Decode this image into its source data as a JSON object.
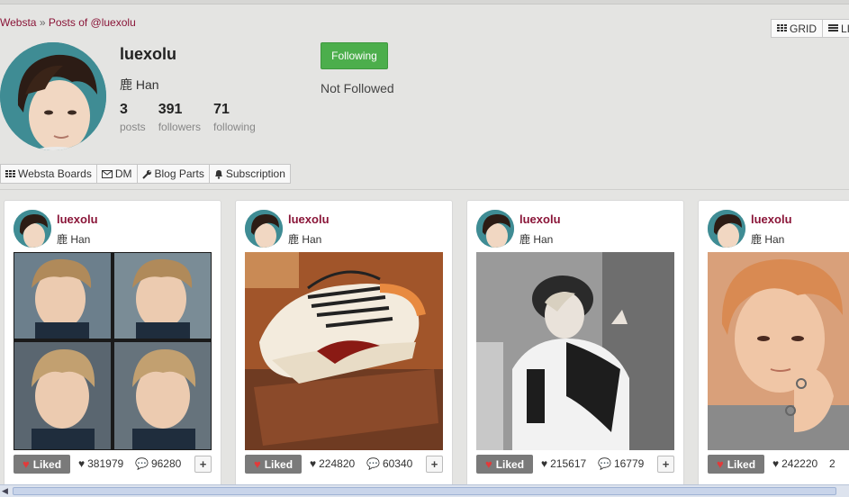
{
  "breadcrumb": {
    "home": "Websta",
    "separator": "»",
    "current": "Posts of @luexolu"
  },
  "view_toggle": {
    "grid": "GRID",
    "list": "LI"
  },
  "profile": {
    "username": "luexolu",
    "full_name": "鹿 Han",
    "stats": [
      {
        "value": "3",
        "label": "posts"
      },
      {
        "value": "391",
        "label": "followers"
      },
      {
        "value": "71",
        "label": "following"
      }
    ],
    "follow_button": "Following",
    "follow_status": "Not Followed"
  },
  "toolbar": {
    "boards": "Websta Boards",
    "dm": "DM",
    "blog_parts": "Blog Parts",
    "subscription": "Subscription"
  },
  "posts": [
    {
      "username": "luexolu",
      "full_name": "鹿 Han",
      "liked_label": "Liked",
      "likes": "381979",
      "comments": "96280"
    },
    {
      "username": "luexolu",
      "full_name": "鹿 Han",
      "liked_label": "Liked",
      "likes": "224820",
      "comments": "60340"
    },
    {
      "username": "luexolu",
      "full_name": "鹿 Han",
      "liked_label": "Liked",
      "likes": "215617",
      "comments": "16779"
    },
    {
      "username": "luexolu",
      "full_name": "鹿 Han",
      "liked_label": "Liked",
      "likes": "242220",
      "comments": "2"
    }
  ],
  "colors": {
    "accent": "#8a1538",
    "follow_green": "#4cae4c",
    "liked_gray": "#7a7a7a",
    "background": "#e4e4e2"
  }
}
